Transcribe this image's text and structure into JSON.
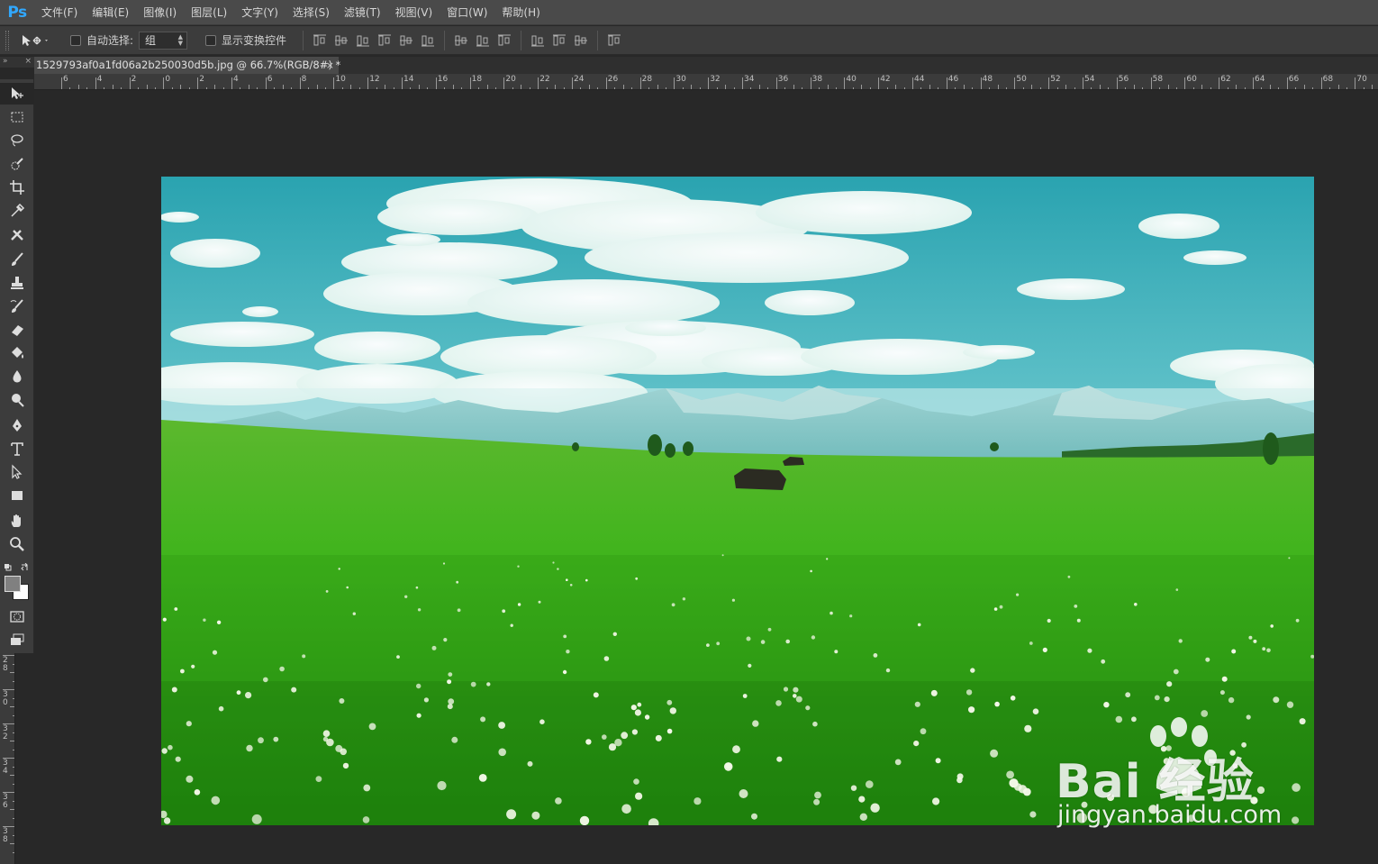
{
  "app": {
    "logo": "Ps"
  },
  "menu": [
    {
      "label": "文件(F)"
    },
    {
      "label": "编辑(E)"
    },
    {
      "label": "图像(I)"
    },
    {
      "label": "图层(L)"
    },
    {
      "label": "文字(Y)"
    },
    {
      "label": "选择(S)"
    },
    {
      "label": "滤镜(T)"
    },
    {
      "label": "视图(V)"
    },
    {
      "label": "窗口(W)"
    },
    {
      "label": "帮助(H)"
    }
  ],
  "options": {
    "auto_select_label": "自动选择:",
    "auto_select_checked": false,
    "auto_select_value": "组",
    "show_transform_label": "显示变换控件",
    "show_transform_checked": false
  },
  "document": {
    "tab_label": "1529793af0a1fd06a2b250030d5b.jpg @ 66.7%(RGB/8#) *",
    "close_glyph": "×"
  },
  "rulers": {
    "horizontal_labels": [
      "6",
      "4",
      "2",
      "0",
      "2",
      "4",
      "6",
      "8",
      "10",
      "12",
      "14",
      "16",
      "18",
      "20",
      "22",
      "24",
      "26",
      "28",
      "30",
      "32",
      "34",
      "36",
      "38",
      "40",
      "42",
      "44",
      "46",
      "48",
      "50",
      "52",
      "54",
      "56",
      "58",
      "60",
      "62",
      "64",
      "66",
      "68",
      "70"
    ],
    "vertical_labels": [
      "2\n8",
      "3\n0",
      "3\n2",
      "3\n4",
      "3\n6",
      "3\n8"
    ]
  },
  "panel": {
    "collapse_glyph": "»",
    "close_glyph": "×"
  },
  "tools": [
    {
      "name": "move-tool",
      "icon": "move-icon",
      "active": true
    },
    {
      "name": "rectangular-marquee-tool",
      "icon": "marquee-icon"
    },
    {
      "name": "lasso-tool",
      "icon": "lasso-icon"
    },
    {
      "name": "quick-selection-tool",
      "icon": "quick-selection-icon"
    },
    {
      "name": "crop-tool",
      "icon": "crop-icon"
    },
    {
      "name": "eyedropper-tool",
      "icon": "eyedropper-icon"
    },
    {
      "name": "healing-brush-tool",
      "icon": "healing-icon"
    },
    {
      "name": "brush-tool",
      "icon": "brush-icon"
    },
    {
      "name": "clone-stamp-tool",
      "icon": "stamp-icon"
    },
    {
      "name": "history-brush-tool",
      "icon": "history-brush-icon"
    },
    {
      "name": "eraser-tool",
      "icon": "eraser-icon"
    },
    {
      "name": "paint-bucket-tool",
      "icon": "bucket-icon"
    },
    {
      "name": "blur-tool",
      "icon": "blur-drop-icon"
    },
    {
      "name": "dodge-tool",
      "icon": "dodge-icon"
    },
    {
      "name": "pen-tool",
      "icon": "pen-icon"
    },
    {
      "name": "type-tool",
      "icon": "type-icon"
    },
    {
      "name": "path-selection-tool",
      "icon": "path-selection-icon"
    },
    {
      "name": "rectangle-tool",
      "icon": "rectangle-icon"
    },
    {
      "name": "hand-tool",
      "icon": "hand-icon"
    },
    {
      "name": "zoom-tool",
      "icon": "zoom-icon"
    }
  ],
  "colors": {
    "foreground": "#808080",
    "background": "#ffffff",
    "chrome": "#3c3c3c",
    "workspace": "#282828"
  },
  "watermark": {
    "brand": "Bai  经验",
    "url": "jingyan.baidu.com"
  }
}
